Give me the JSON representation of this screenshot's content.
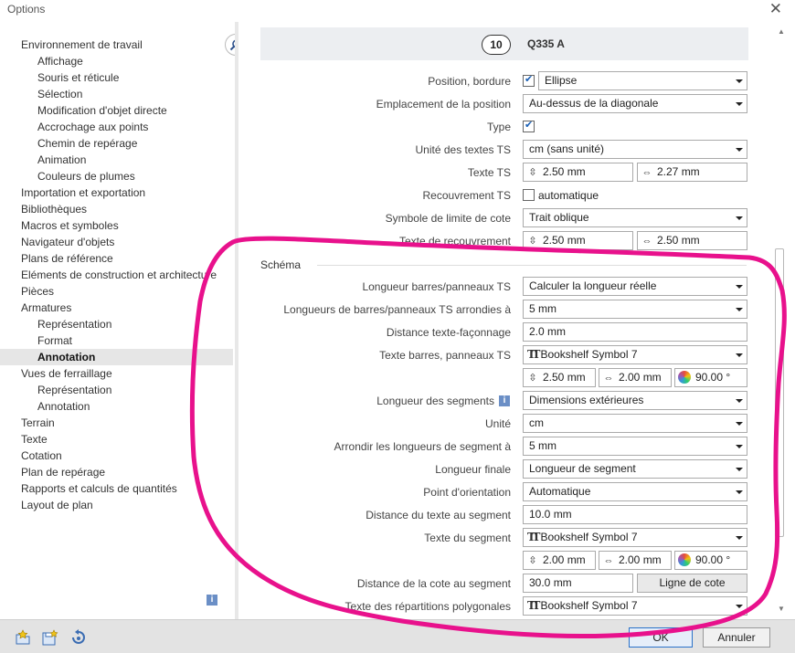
{
  "window": {
    "title": "Options",
    "close_icon": "close-icon"
  },
  "tree": {
    "items": [
      {
        "label": "Environnement de travail",
        "level": 0
      },
      {
        "label": "Affichage",
        "level": 1
      },
      {
        "label": "Souris et réticule",
        "level": 1
      },
      {
        "label": "Sélection",
        "level": 1
      },
      {
        "label": "Modification d'objet directe",
        "level": 1
      },
      {
        "label": "Accrochage aux points",
        "level": 1
      },
      {
        "label": "Chemin de repérage",
        "level": 1
      },
      {
        "label": "Animation",
        "level": 1
      },
      {
        "label": "Couleurs de plumes",
        "level": 1
      },
      {
        "label": "Importation et exportation",
        "level": 0
      },
      {
        "label": "Bibliothèques",
        "level": 0
      },
      {
        "label": "Macros et symboles",
        "level": 0
      },
      {
        "label": "Navigateur d'objets",
        "level": 0
      },
      {
        "label": "Plans de référence",
        "level": 0
      },
      {
        "label": "Eléments de construction et architecture",
        "level": 0
      },
      {
        "label": "Pièces",
        "level": 0
      },
      {
        "label": "Armatures",
        "level": 0
      },
      {
        "label": "Représentation",
        "level": 1
      },
      {
        "label": "Format",
        "level": 1
      },
      {
        "label": "Annotation",
        "level": 1,
        "selected": true
      },
      {
        "label": "Vues de ferraillage",
        "level": 0
      },
      {
        "label": "Représentation",
        "level": 1
      },
      {
        "label": "Annotation",
        "level": 1
      },
      {
        "label": "Terrain",
        "level": 0
      },
      {
        "label": "Texte",
        "level": 0
      },
      {
        "label": "Cotation",
        "level": 0
      },
      {
        "label": "Plan de repérage",
        "level": 0
      },
      {
        "label": "Rapports et calculs de quantités",
        "level": 0
      },
      {
        "label": "Layout de plan",
        "level": 0
      }
    ]
  },
  "header": {
    "number": "10",
    "grade": "Q335 A"
  },
  "form": {
    "position_bordure": {
      "label": "Position, bordure",
      "checked": true,
      "value": "Ellipse"
    },
    "emplacement": {
      "label": "Emplacement de la position",
      "value": "Au-dessus de la diagonale"
    },
    "type": {
      "label": "Type",
      "checked": true
    },
    "unite_ts": {
      "label": "Unité des textes TS",
      "value": "cm (sans unité)"
    },
    "texte_ts": {
      "label": "Texte TS",
      "height": "2.50 mm",
      "width": "2.27 mm"
    },
    "recouvrement_ts": {
      "label": "Recouvrement TS",
      "checked": false,
      "option": "automatique"
    },
    "symbole_limite": {
      "label": "Symbole de limite de cote",
      "value": "Trait oblique"
    },
    "texte_recouvrement": {
      "label": "Texte de recouvrement",
      "height": "2.50 mm",
      "width": "2.50 mm"
    }
  },
  "schema": {
    "title": "Schéma",
    "longueur_barres": {
      "label": "Longueur barres/panneaux TS",
      "value": "Calculer la longueur réelle"
    },
    "longueurs_arrondies": {
      "label": "Longueurs de barres/panneaux TS arrondies à",
      "value": "5 mm"
    },
    "distance_texte_faconnage": {
      "label": "Distance texte-façonnage",
      "value": "2.0 mm"
    },
    "texte_barres": {
      "label": "Texte barres, panneaux TS",
      "font": "Bookshelf Symbol 7",
      "height": "2.50 mm",
      "width": "2.00 mm",
      "angle": "90.00 °"
    },
    "longueur_segments": {
      "label": "Longueur des segments",
      "value": "Dimensions extérieures"
    },
    "unite": {
      "label": "Unité",
      "value": "cm"
    },
    "arrondir_segment": {
      "label": "Arrondir les longueurs de segment à",
      "value": "5 mm"
    },
    "longueur_finale": {
      "label": "Longueur finale",
      "value": "Longueur de segment"
    },
    "point_orientation": {
      "label": "Point d'orientation",
      "value": "Automatique"
    },
    "distance_texte_segment": {
      "label": "Distance du texte au segment",
      "value": "10.0 mm"
    },
    "texte_segment": {
      "label": "Texte du segment",
      "font": "Bookshelf Symbol 7",
      "height": "2.00 mm",
      "width": "2.00 mm",
      "angle": "90.00 °"
    },
    "distance_cote_segment": {
      "label": "Distance de la cote au segment",
      "value": "30.0 mm",
      "button": "Ligne de cote"
    },
    "texte_repartitions": {
      "label": "Texte des répartitions polygonales",
      "font": "Bookshelf Symbol 7"
    }
  },
  "footer": {
    "ok": "OK",
    "cancel": "Annuler"
  },
  "colors": {
    "annotation": "#e8118c",
    "selected_bg": "#e6e6e6",
    "header_band": "#eceef1"
  }
}
